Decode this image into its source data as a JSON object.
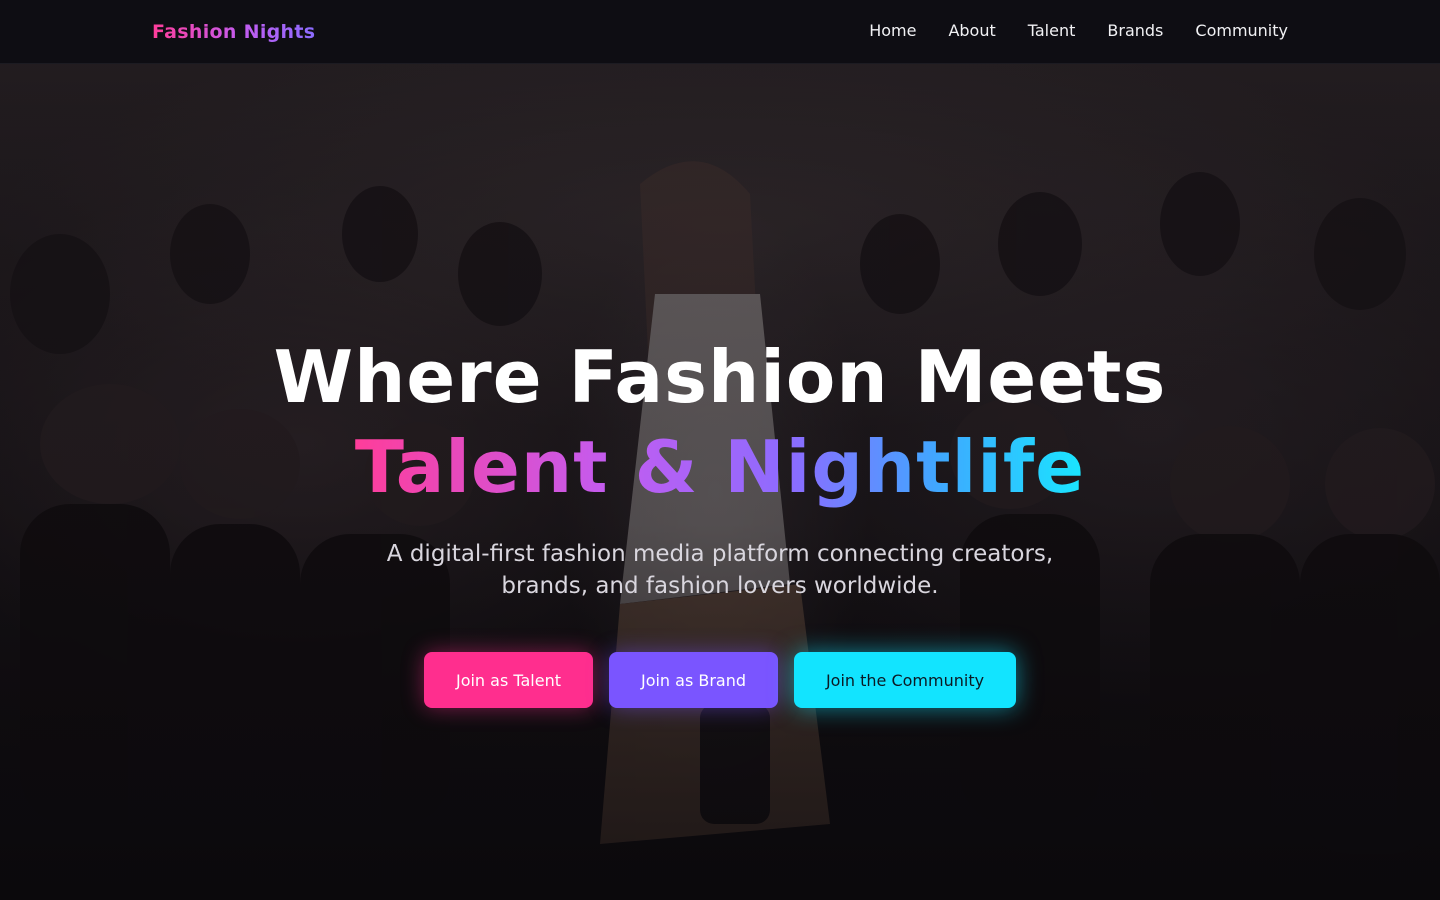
{
  "nav": {
    "logo": "Fashion Nights",
    "links": [
      "Home",
      "About",
      "Talent",
      "Brands",
      "Community"
    ]
  },
  "hero": {
    "headline_line1": "Where Fashion Meets",
    "headline_line2": "Talent & Nightlife",
    "subtitle": "A digital-first fashion media platform connecting creators, brands, and fashion lovers worldwide.",
    "buttons": {
      "talent": "Join as Talent",
      "brand": "Join as Brand",
      "community": "Join the Community"
    },
    "background_image": "runway-fashion-show-photo"
  },
  "colors": {
    "pink": "#ff2e8e",
    "purple": "#7a55ff",
    "cyan": "#12e4ff",
    "nav_background": "#0e0d13"
  }
}
